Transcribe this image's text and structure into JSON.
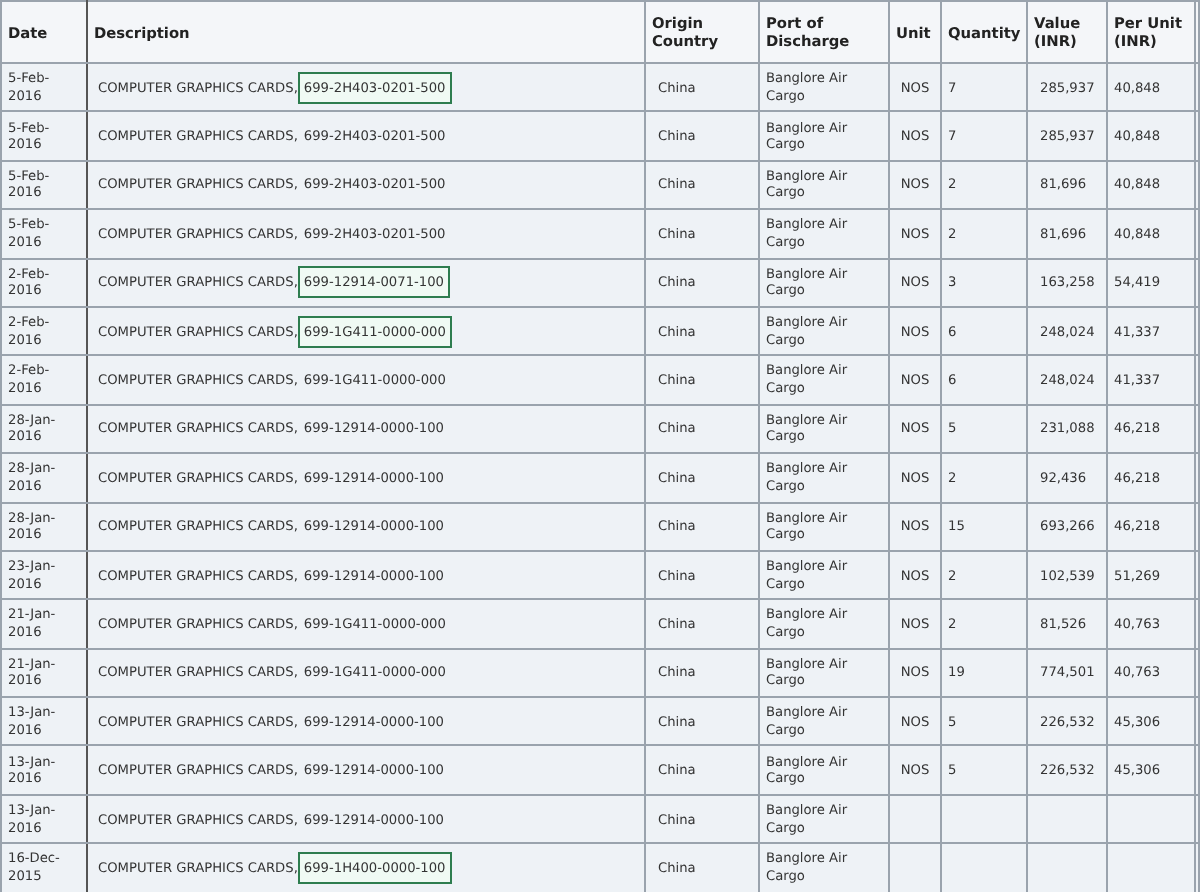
{
  "table": {
    "columns": [
      "Date",
      "Description",
      "Origin Country",
      "Port of Discharge",
      "Unit",
      "Quantity",
      "Value (INR)",
      "Per Unit (INR)"
    ],
    "rows": [
      {
        "date": "5-Feb-2016",
        "description": "COMPUTER GRAPHICS CARDS,",
        "part": "699-2H403-0201-500",
        "highlighted": true,
        "origin": "China",
        "port": "Banglore Air Cargo",
        "unit": "NOS",
        "quantity": "7",
        "value": "285,937",
        "per_unit": "40,848"
      },
      {
        "date": "5-Feb-2016",
        "description": "COMPUTER GRAPHICS CARDS,",
        "part": "699-2H403-0201-500",
        "highlighted": false,
        "origin": "China",
        "port": "Banglore Air Cargo",
        "unit": "NOS",
        "quantity": "7",
        "value": "285,937",
        "per_unit": "40,848"
      },
      {
        "date": "5-Feb-2016",
        "description": "COMPUTER GRAPHICS CARDS,",
        "part": "699-2H403-0201-500",
        "highlighted": false,
        "origin": "China",
        "port": "Banglore Air Cargo",
        "unit": "NOS",
        "quantity": "2",
        "value": "81,696",
        "per_unit": "40,848"
      },
      {
        "date": "5-Feb-2016",
        "description": "COMPUTER GRAPHICS CARDS,",
        "part": "699-2H403-0201-500",
        "highlighted": false,
        "origin": "China",
        "port": "Banglore Air Cargo",
        "unit": "NOS",
        "quantity": "2",
        "value": "81,696",
        "per_unit": "40,848"
      },
      {
        "date": "2-Feb-2016",
        "description": "COMPUTER GRAPHICS CARDS,",
        "part": "699-12914-0071-100",
        "highlighted": true,
        "origin": "China",
        "port": "Banglore Air Cargo",
        "unit": "NOS",
        "quantity": "3",
        "value": "163,258",
        "per_unit": "54,419"
      },
      {
        "date": "2-Feb-2016",
        "description": "COMPUTER GRAPHICS CARDS,",
        "part": "699-1G411-0000-000",
        "highlighted": true,
        "origin": "China",
        "port": "Banglore Air Cargo",
        "unit": "NOS",
        "quantity": "6",
        "value": "248,024",
        "per_unit": "41,337"
      },
      {
        "date": "2-Feb-2016",
        "description": "COMPUTER GRAPHICS CARDS,",
        "part": "699-1G411-0000-000",
        "highlighted": false,
        "origin": "China",
        "port": "Banglore Air Cargo",
        "unit": "NOS",
        "quantity": "6",
        "value": "248,024",
        "per_unit": "41,337"
      },
      {
        "date": "28-Jan-2016",
        "description": "COMPUTER GRAPHICS CARDS,",
        "part": "699-12914-0000-100",
        "highlighted": false,
        "origin": "China",
        "port": "Banglore Air Cargo",
        "unit": "NOS",
        "quantity": "5",
        "value": "231,088",
        "per_unit": "46,218"
      },
      {
        "date": "28-Jan-2016",
        "description": "COMPUTER GRAPHICS CARDS,",
        "part": "699-12914-0000-100",
        "highlighted": false,
        "origin": "China",
        "port": "Banglore Air Cargo",
        "unit": "NOS",
        "quantity": "2",
        "value": "92,436",
        "per_unit": "46,218"
      },
      {
        "date": "28-Jan-2016",
        "description": "COMPUTER GRAPHICS CARDS,",
        "part": "699-12914-0000-100",
        "highlighted": false,
        "origin": "China",
        "port": "Banglore Air Cargo",
        "unit": "NOS",
        "quantity": "15",
        "value": "693,266",
        "per_unit": "46,218"
      },
      {
        "date": "23-Jan-2016",
        "description": "COMPUTER GRAPHICS CARDS,",
        "part": "699-12914-0000-100",
        "highlighted": false,
        "origin": "China",
        "port": "Banglore Air Cargo",
        "unit": "NOS",
        "quantity": "2",
        "value": "102,539",
        "per_unit": "51,269"
      },
      {
        "date": "21-Jan-2016",
        "description": "COMPUTER GRAPHICS CARDS,",
        "part": "699-1G411-0000-000",
        "highlighted": false,
        "origin": "China",
        "port": "Banglore Air Cargo",
        "unit": "NOS",
        "quantity": "2",
        "value": "81,526",
        "per_unit": "40,763"
      },
      {
        "date": "21-Jan-2016",
        "description": "COMPUTER GRAPHICS CARDS,",
        "part": "699-1G411-0000-000",
        "highlighted": false,
        "origin": "China",
        "port": "Banglore Air Cargo",
        "unit": "NOS",
        "quantity": "19",
        "value": "774,501",
        "per_unit": "40,763"
      },
      {
        "date": "13-Jan-2016",
        "description": "COMPUTER GRAPHICS CARDS,",
        "part": "699-12914-0000-100",
        "highlighted": false,
        "origin": "China",
        "port": "Banglore Air Cargo",
        "unit": "NOS",
        "quantity": "5",
        "value": "226,532",
        "per_unit": "45,306"
      },
      {
        "date": "13-Jan-2016",
        "description": "COMPUTER GRAPHICS CARDS,",
        "part": "699-12914-0000-100",
        "highlighted": false,
        "origin": "China",
        "port": "Banglore Air Cargo",
        "unit": "NOS",
        "quantity": "5",
        "value": "226,532",
        "per_unit": "45,306"
      },
      {
        "date": "13-Jan-2016",
        "description": "COMPUTER GRAPHICS CARDS,",
        "part": "699-12914-0000-100",
        "highlighted": false,
        "origin": "China",
        "port": "Banglore Air Cargo"
      },
      {
        "date": "16-Dec-2015",
        "description": "COMPUTER GRAPHICS CARDS,",
        "part": "699-1H400-0000-100",
        "highlighted": true,
        "origin": "China",
        "port": "Banglore Air Cargo"
      }
    ]
  }
}
